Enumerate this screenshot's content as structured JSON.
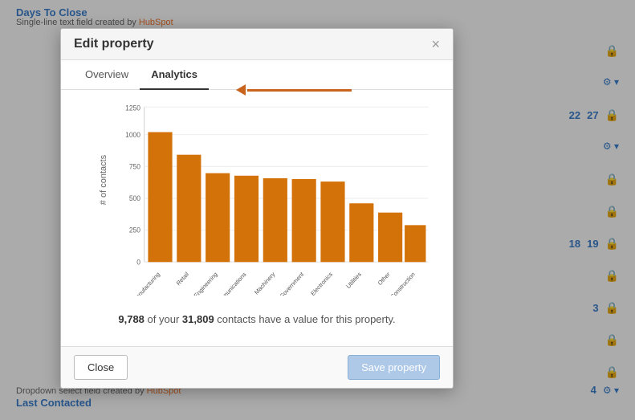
{
  "background": {
    "title": "Days To Close",
    "subtitle_prefix": "Single-line text field created by ",
    "hubspot_label": "HubSpot",
    "numbers_row1": {
      "val1": "22",
      "val2": "27"
    },
    "numbers_row2": {
      "val1": "18",
      "val2": "19"
    },
    "number_row3": "3",
    "number_row4": "4",
    "bottom_text": "Dropdown select field created by ",
    "bottom_hubspot": "HubSpot",
    "bottom_title": "Last Contacted"
  },
  "modal": {
    "title": "Edit property",
    "close_label": "×",
    "tabs": [
      {
        "label": "Overview",
        "active": false
      },
      {
        "label": "Analytics",
        "active": true
      }
    ],
    "chart": {
      "y_label": "# of contacts",
      "y_ticks": [
        "0",
        "250",
        "500",
        "750",
        "1000",
        "1250"
      ],
      "bars": [
        {
          "label": "Manufacturing",
          "value": 1020,
          "max": 1250
        },
        {
          "label": "Retail",
          "value": 840,
          "max": 1250
        },
        {
          "label": "Engineering",
          "value": 700,
          "max": 1250
        },
        {
          "label": "Telecommunications",
          "value": 675,
          "max": 1250
        },
        {
          "label": "Machinery",
          "value": 660,
          "max": 1250
        },
        {
          "label": "Government",
          "value": 650,
          "max": 1250
        },
        {
          "label": "Electronics",
          "value": 630,
          "max": 1250
        },
        {
          "label": "Utilities",
          "value": 460,
          "max": 1250
        },
        {
          "label": "Other",
          "value": 390,
          "max": 1250
        },
        {
          "label": "Construction",
          "value": 290,
          "max": 1250
        }
      ],
      "bar_color": "#d4720a"
    },
    "stats": {
      "count": "9,788",
      "total": "31,809",
      "text": "of your {total} contacts have a value for this property."
    },
    "footer": {
      "close_label": "Close",
      "save_label": "Save property"
    }
  },
  "arrow": {
    "color": "#c8641e"
  }
}
